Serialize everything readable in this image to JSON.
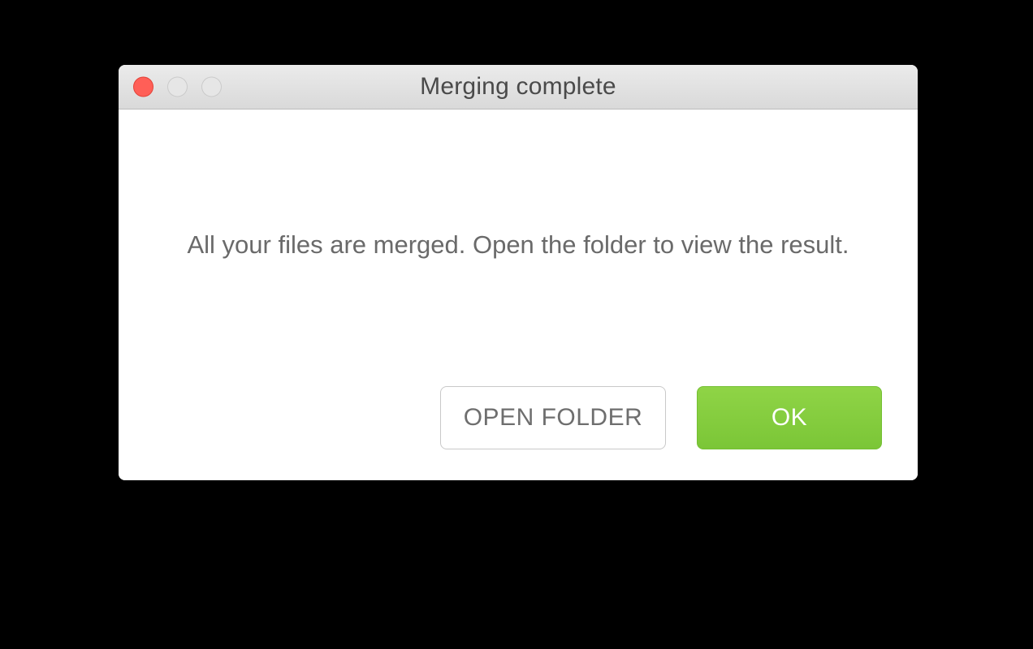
{
  "window": {
    "title": "Merging complete"
  },
  "dialog": {
    "message": "All your files are merged. Open the folder to view the result."
  },
  "buttons": {
    "open_folder_label": "OPEN FOLDER",
    "ok_label": "OK"
  },
  "colors": {
    "close_button": "#ff5f57",
    "primary_button": "#7bc637"
  }
}
